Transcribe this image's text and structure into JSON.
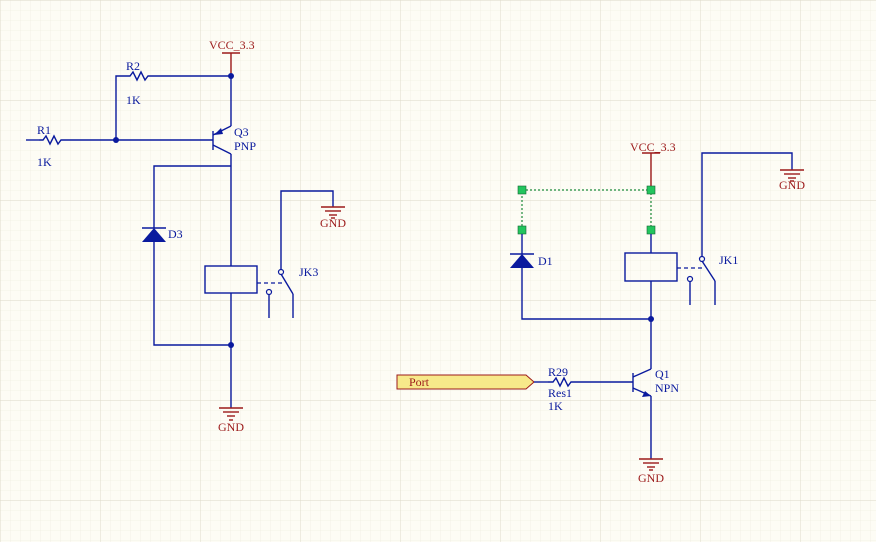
{
  "colors": {
    "background": "#fdfcf5",
    "grid_minor": "#ece9dc",
    "grid_major": "#dcd8c8",
    "wire": "#0a1a9e",
    "power": "#9c1a1a",
    "port_fill": "#f7e98a",
    "selection_handle": "#22c55e"
  },
  "left_circuit": {
    "vcc_label": "VCC_3.3",
    "gnd_label": "GND",
    "r1": {
      "designator": "R1",
      "value": "1K"
    },
    "r2": {
      "designator": "R2",
      "value": "1K"
    },
    "q3": {
      "designator": "Q3",
      "type": "PNP"
    },
    "d3": {
      "designator": "D3"
    },
    "jk3": {
      "designator": "JK3",
      "gnd_label": "GND"
    }
  },
  "right_circuit": {
    "vcc_label": "VCC_3.3",
    "gnd_label": "GND",
    "port": {
      "label": "Port"
    },
    "r29": {
      "designator": "R29",
      "comment": "Res1",
      "value": "1K"
    },
    "q1": {
      "designator": "Q1",
      "type": "NPN"
    },
    "d1": {
      "designator": "D1"
    },
    "jk1": {
      "designator": "JK1",
      "gnd_label": "GND"
    }
  }
}
